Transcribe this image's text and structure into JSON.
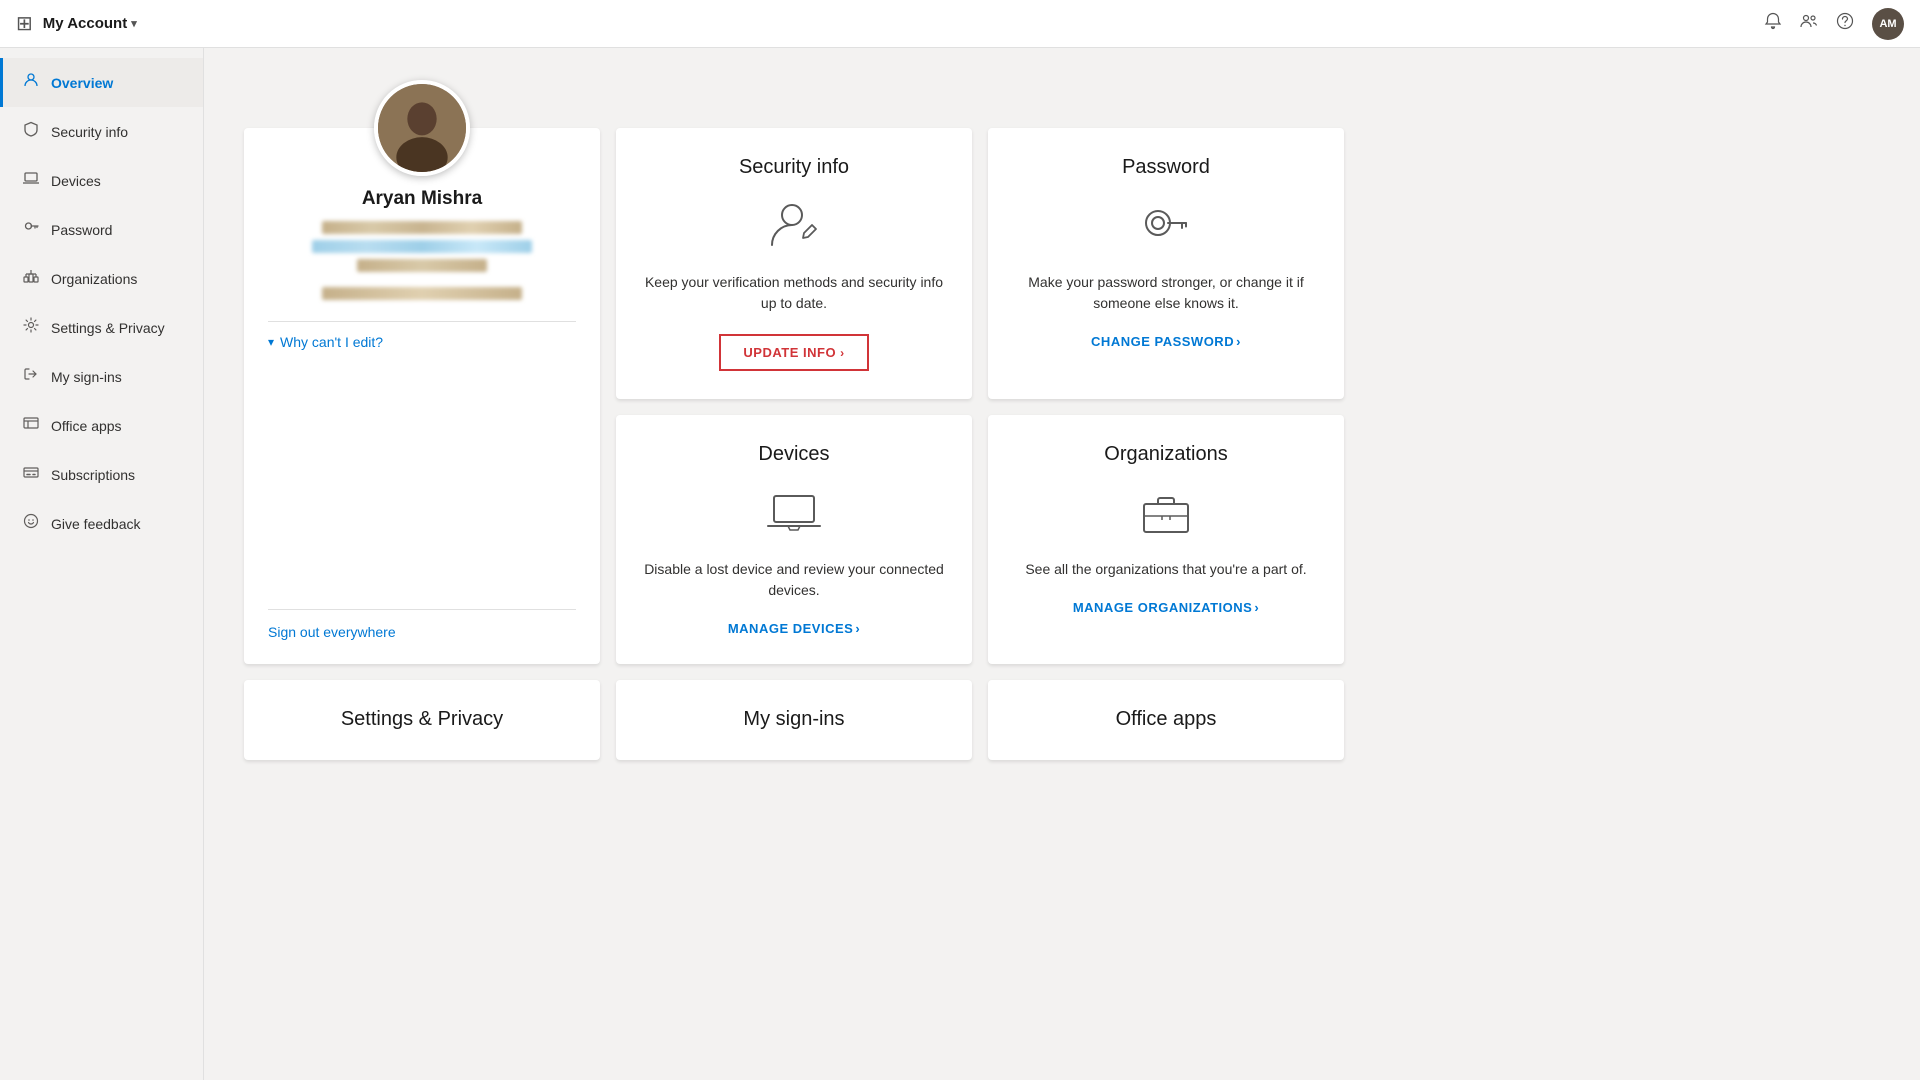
{
  "topbar": {
    "grid_icon": "⊞",
    "title": "My Account",
    "chevron": "▾",
    "icons": [
      "notification",
      "people",
      "help"
    ],
    "avatar_initials": "AM"
  },
  "sidebar": {
    "items": [
      {
        "id": "overview",
        "label": "Overview",
        "icon": "person",
        "active": true
      },
      {
        "id": "security-info",
        "label": "Security info",
        "icon": "shield"
      },
      {
        "id": "devices",
        "label": "Devices",
        "icon": "laptop"
      },
      {
        "id": "password",
        "label": "Password",
        "icon": "key"
      },
      {
        "id": "organizations",
        "label": "Organizations",
        "icon": "org"
      },
      {
        "id": "settings-privacy",
        "label": "Settings & Privacy",
        "icon": "settings"
      },
      {
        "id": "my-sign-ins",
        "label": "My sign-ins",
        "icon": "signin"
      },
      {
        "id": "office-apps",
        "label": "Office apps",
        "icon": "office"
      },
      {
        "id": "subscriptions",
        "label": "Subscriptions",
        "icon": "subscriptions"
      },
      {
        "id": "give-feedback",
        "label": "Give feedback",
        "icon": "feedback"
      }
    ]
  },
  "profile_card": {
    "name": "Aryan Mishra",
    "why_edit_label": "Why can't I edit?",
    "sign_out_label": "Sign out everywhere"
  },
  "cards": [
    {
      "id": "security-info",
      "title": "Security info",
      "description": "Keep your verification methods and security info up to date.",
      "action_label": "UPDATE INFO",
      "action_type": "button"
    },
    {
      "id": "password",
      "title": "Password",
      "description": "Make your password stronger, or change it if someone else knows it.",
      "action_label": "CHANGE PASSWORD",
      "action_type": "link"
    },
    {
      "id": "devices",
      "title": "Devices",
      "description": "Disable a lost device and review your connected devices.",
      "action_label": "MANAGE DEVICES",
      "action_type": "link"
    },
    {
      "id": "organizations",
      "title": "Organizations",
      "description": "See all the organizations that you're a part of.",
      "action_label": "MANAGE ORGANIZATIONS",
      "action_type": "link"
    }
  ],
  "bottom_cards": [
    {
      "id": "settings-privacy",
      "title": "Settings & Privacy"
    },
    {
      "id": "my-sign-ins",
      "title": "My sign-ins"
    },
    {
      "id": "office-apps",
      "title": "Office apps"
    }
  ]
}
